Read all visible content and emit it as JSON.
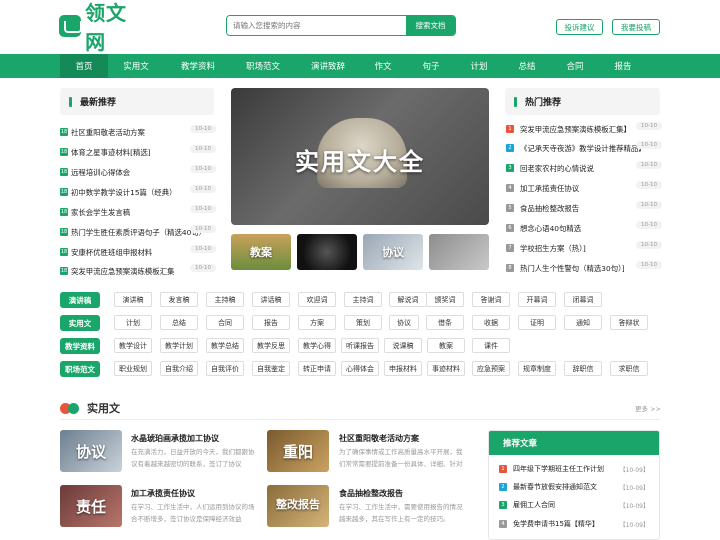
{
  "brand": {
    "logo_text": "领文网",
    "color": "#1aa56a"
  },
  "search": {
    "placeholder": "请输入您搜索的内容",
    "button": "搜索文档"
  },
  "header_buttons": {
    "feedback": "投诉建议",
    "contribute": "我要投稿"
  },
  "nav": [
    "首页",
    "实用文",
    "教学资料",
    "职场范文",
    "演讲致辞",
    "作文",
    "句子",
    "计划",
    "总结",
    "合同",
    "报告"
  ],
  "latest": {
    "title": "最新推荐",
    "items": [
      {
        "label": "社区重阳敬老活动方案",
        "date": "10-10"
      },
      {
        "label": "体育之星事迹材料[精选]",
        "date": "10-10"
      },
      {
        "label": "远程培训心得体会",
        "date": "10-10"
      },
      {
        "label": "初中数学教学设计15篇（经典）",
        "date": "10-10"
      },
      {
        "label": "家长会学生发言稿",
        "date": "10-10"
      },
      {
        "label": "热门学生胜任素质评语句子（精选40句）",
        "date": "10-10"
      },
      {
        "label": "安康杯优胜班组申报材料",
        "date": "10-10"
      },
      {
        "label": "突发甲流应急预案演练模板汇集",
        "date": "10-10"
      }
    ]
  },
  "banner": {
    "text": "实用文大全",
    "thumbs": [
      "教案",
      "",
      "协议",
      ""
    ]
  },
  "hot": {
    "title": "热门推荐",
    "items": [
      {
        "label": "突发甲流应急预案演练模板汇集】",
        "date": "10-10",
        "color": "#e6553e"
      },
      {
        "label": "《记承天寺夜游》教学设计推荐精品】",
        "date": "10-10",
        "color": "#1aa5d8"
      },
      {
        "label": "回老家农村的心情说说",
        "date": "10-10",
        "color": "#1aa56a"
      },
      {
        "label": "加工承揽责任协议",
        "date": "10-10",
        "color": "#999999"
      },
      {
        "label": "食品抽检整改报告",
        "date": "10-10",
        "color": "#999999"
      },
      {
        "label": "想念心语40句精选",
        "date": "10-10",
        "color": "#999999"
      },
      {
        "label": "学校招生方案（热）]",
        "date": "10-10",
        "color": "#999999"
      },
      {
        "label": "热门人生个性警句（精选30句）]",
        "date": "10-10",
        "color": "#999999"
      }
    ]
  },
  "tag_rows": [
    {
      "cat": "演讲稿",
      "tags": [
        "演讲稿",
        "发言稿",
        "主持稿",
        "讲话稿",
        "欢迎词",
        "主持词",
        "解说词",
        "颁奖词",
        "答谢词",
        "开幕词",
        "闭幕词"
      ]
    },
    {
      "cat": "实用文",
      "tags": [
        "计划",
        "总结",
        "合同",
        "报告",
        "方案",
        "策划",
        "协议",
        "借条",
        "收据",
        "证明",
        "通知",
        "答辩状"
      ]
    },
    {
      "cat": "教学资料",
      "tags": [
        "教学设计",
        "教学计划",
        "教学总结",
        "教学反思",
        "教学心得",
        "听课报告",
        "说课稿",
        "教案",
        "课件"
      ]
    },
    {
      "cat": "职场范文",
      "tags": [
        "职业规划",
        "自我介绍",
        "自我评价",
        "自我鉴定",
        "转正申请",
        "心得体会",
        "申报材料",
        "事迹材料",
        "应急预案",
        "规章制度",
        "辞职信",
        "求职信"
      ]
    }
  ],
  "section": {
    "title": "实用文",
    "more": "更多 >>"
  },
  "articles": [
    {
      "img": "协议",
      "title": "水晶琥珀画承揽加工协议",
      "desc": "在充满活力，日益开放的今天，我们都跟协议有着越来越密切的联系，签订了协议"
    },
    {
      "img": "重阳",
      "title": "社区重阳敬老活动方案",
      "desc": "为了确保事情或工作高质量高水平开展，我们常常需要提前准备一份具体、详细、针对性"
    },
    {
      "img": "责任",
      "title": "加工承揽责任协议",
      "desc": "在学习、工作生活中，人们运用到协议的场合不断增多，签订协议是保障经济效益"
    },
    {
      "img": "整改报告",
      "title": "食品抽检整改报告",
      "desc": "在学习、工作生活中，需要使用报告的情况越来越多，其在写作上有一定的技巧。"
    }
  ],
  "recommend": {
    "title": "推荐文章",
    "items": [
      {
        "label": "四年级下学期班主任工作计划",
        "date": "【10-09】",
        "color": "#e6553e"
      },
      {
        "label": "最新春节放假安排通知范文",
        "date": "【10-09】",
        "color": "#1aa5d8"
      },
      {
        "label": "雇佣工人合同",
        "date": "【10-09】",
        "color": "#1aa56a"
      },
      {
        "label": "免学费申请书15篇【精华】",
        "date": "【10-09】",
        "color": "#999999"
      }
    ]
  }
}
